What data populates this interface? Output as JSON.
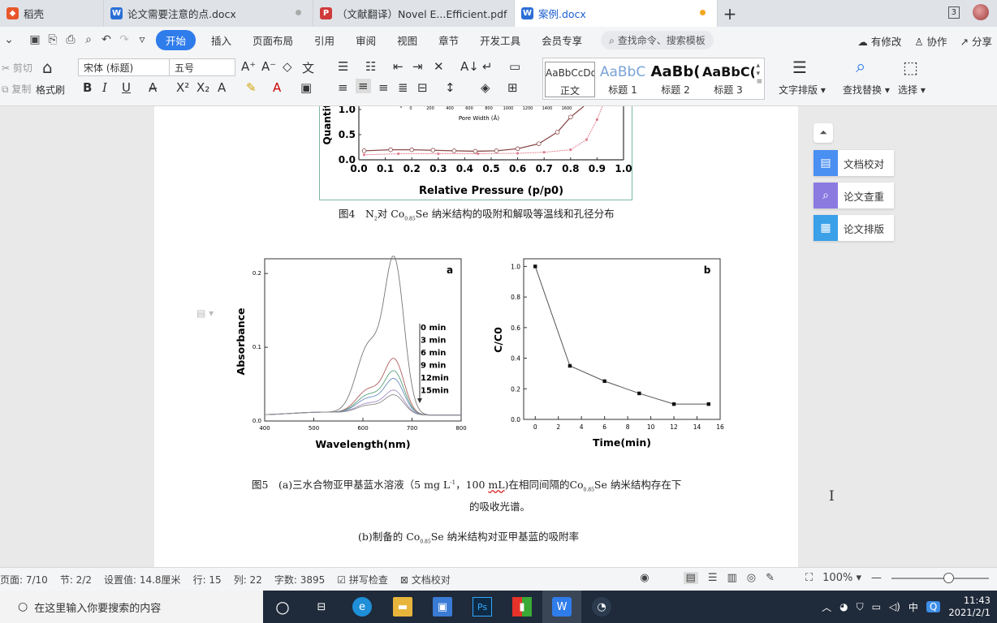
{
  "tabs": [
    {
      "label": "稻壳",
      "icon": "wps-docer-icon",
      "color": "#e8562a"
    },
    {
      "label": "论文需要注意的点.docx",
      "icon": "word-doc-icon",
      "color": "#2b6fd6"
    },
    {
      "label": "（文献翻译）Novel E...Efficient.pdf",
      "icon": "pdf-icon",
      "color": "#d03a3a"
    },
    {
      "label": "案例.docx",
      "icon": "word-doc-icon",
      "color": "#2b6fd6"
    }
  ],
  "tab_add": "+",
  "page_count_badge": "3",
  "menu": {
    "items": [
      "开始",
      "插入",
      "页面布局",
      "引用",
      "审阅",
      "视图",
      "章节",
      "开发工具",
      "会员专享"
    ],
    "active_index": 0,
    "search_placeholder": "查找命令、搜索模板",
    "right": [
      "有修改",
      "协作",
      "分享"
    ]
  },
  "ribbon": {
    "cut": "剪切",
    "copy": "复制",
    "format_painter": "格式刷",
    "font_name": "宋体 (标题)",
    "font_size": "五号",
    "styles": [
      {
        "preview": "AaBbCcDd",
        "name": "正文"
      },
      {
        "preview": "AaBbC",
        "name": "标题 1"
      },
      {
        "preview": "AaBb(",
        "name": "标题 2"
      },
      {
        "preview": "AaBbC(",
        "name": "标题 3"
      }
    ],
    "text_layout": "文字排版",
    "find_replace": "查找替换",
    "select": "选择"
  },
  "document": {
    "fig4_caption": {
      "prefix": "图4　N",
      "n_sub": "2",
      "middle": "对 Co",
      "co_sub": "0.85",
      "suffix": "Se 纳米结构的吸附和解吸等温线和孔径分布"
    },
    "fig5_caption_line1": {
      "prefix": "图5　(a)三水合物亚甲基蓝水溶液（",
      "conc": "5 mg L",
      "conc_sup": "-1",
      "vol": "，100 ",
      "vol_unit": "mL",
      "mid": ")在相同间隔的Co",
      "co_sub": "0.85",
      "suffix": "Se 纳米结构存在下"
    },
    "fig5_caption_line2": "的吸收光谱。",
    "fig5_caption_b": {
      "prefix": "(b)制备的 Co",
      "co_sub": "0.85",
      "suffix": "Se 纳米结构对亚甲基蓝的吸附率"
    }
  },
  "side_panel": [
    {
      "label": "文档校对",
      "color": "#4a8ff2"
    },
    {
      "label": "论文查重",
      "color": "#8b7be0"
    },
    {
      "label": "论文排版",
      "color": "#3aa0e8"
    }
  ],
  "status": {
    "page": "页面: 7/10",
    "section": "节: 2/2",
    "setting": "设置值: 14.8厘米",
    "row": "行: 15",
    "col": "列: 22",
    "words": "字数: 3895",
    "spell": "拼写检查",
    "proof": "文档校对",
    "zoom": "100%"
  },
  "taskbar": {
    "search_placeholder": "在这里输入你要搜索的内容",
    "time": "11:43",
    "date": "2021/2/1",
    "ime": "中"
  },
  "chart_data": [
    {
      "type": "line",
      "title": "",
      "xlabel": "Relative Pressure (p/p0)",
      "ylabel": "Quantit",
      "xlim": [
        0.0,
        1.0
      ],
      "x_ticks": [
        "0.0",
        "0.1",
        "0.2",
        "0.3",
        "0.4",
        "0.5",
        "0.6",
        "0.7",
        "0.8",
        "0.9",
        "1.0"
      ],
      "y_ticks": [
        "0.0",
        "0.5",
        "1.0"
      ],
      "inset_xlabel": "Pore Width (Å)",
      "inset_x_ticks": [
        "0",
        "200",
        "400",
        "600",
        "800",
        "1000",
        "1200",
        "1400",
        "1600"
      ],
      "series": [
        {
          "name": "",
          "x": [
            0.02,
            0.12,
            0.2,
            0.28,
            0.36,
            0.44,
            0.52,
            0.6,
            0.68,
            0.75,
            0.8,
            0.85
          ],
          "y": [
            0.18,
            0.2,
            0.2,
            0.19,
            0.18,
            0.17,
            0.18,
            0.22,
            0.32,
            0.55,
            0.85,
            1.2
          ]
        },
        {
          "name": "",
          "x": [
            0.02,
            0.15,
            0.3,
            0.45,
            0.6,
            0.7,
            0.8,
            0.86,
            0.9,
            0.92
          ],
          "y": [
            0.1,
            0.12,
            0.12,
            0.12,
            0.13,
            0.15,
            0.2,
            0.4,
            0.8,
            1.2
          ]
        }
      ],
      "grid": false
    },
    {
      "type": "line",
      "panel_label": "a",
      "xlabel": "Wavelength(nm)",
      "ylabel": "Absorbance",
      "xlim": [
        400,
        800
      ],
      "ylim": [
        0.0,
        0.22
      ],
      "x_ticks": [
        400,
        500,
        600,
        700,
        800
      ],
      "y_ticks": [
        "0.0",
        "0.1",
        "0.2"
      ],
      "legend": [
        "0 min",
        "3 min",
        "6 min",
        "9 min",
        "12min",
        "15min"
      ],
      "peaks": [
        0.205,
        0.073,
        0.057,
        0.047,
        0.032,
        0.026
      ],
      "grid": false
    },
    {
      "type": "line",
      "panel_label": "b",
      "xlabel": "Time(min)",
      "ylabel": "C/C0",
      "xlim": [
        -1,
        16
      ],
      "ylim": [
        0.0,
        1.05
      ],
      "x_ticks": [
        0,
        2,
        4,
        6,
        8,
        10,
        12,
        14,
        16
      ],
      "y_ticks": [
        "0.0",
        "0.2",
        "0.4",
        "0.6",
        "0.8",
        "1.0"
      ],
      "x": [
        0,
        3,
        6,
        9,
        12,
        15
      ],
      "y": [
        1.0,
        0.35,
        0.25,
        0.17,
        0.1,
        0.1
      ],
      "grid": false
    }
  ]
}
